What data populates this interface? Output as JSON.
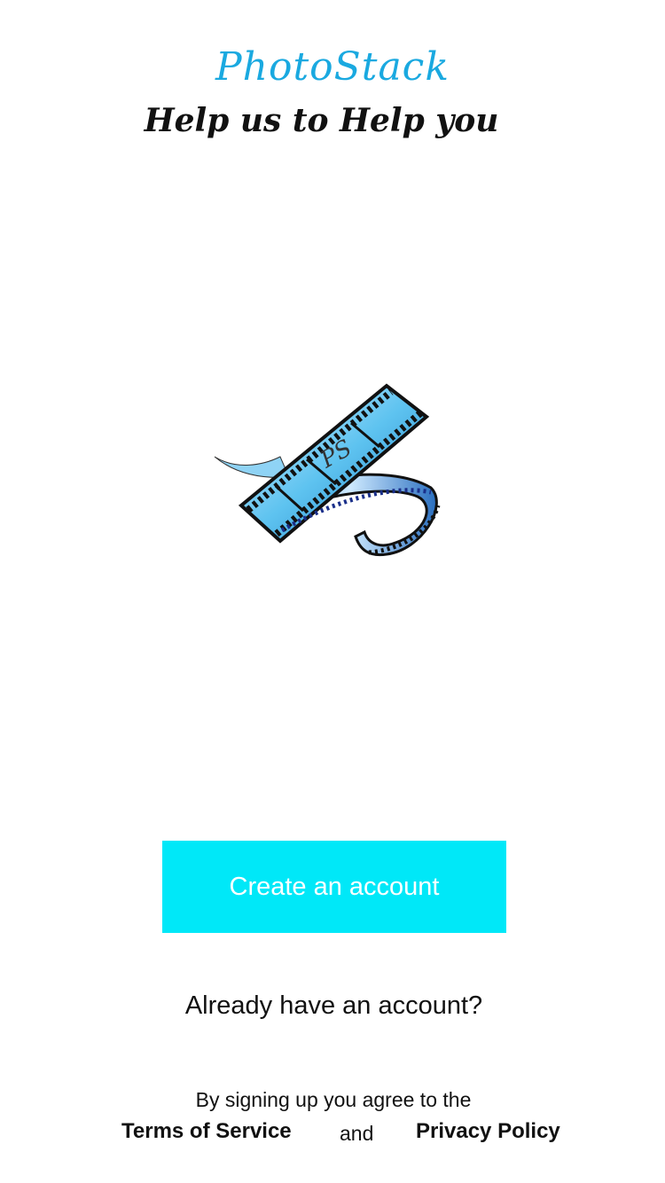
{
  "app": {
    "title": "PhotoStack",
    "subtitle": "Help us to Help you",
    "logo_monogram": "PS",
    "accent_color": "#1aa9e0",
    "button_color": "#00e8f8"
  },
  "actions": {
    "create_account_label": "Create an account",
    "login_label": "Already have an account?"
  },
  "legal": {
    "agree_text": "By signing up you agree to the",
    "terms_label": "Terms of Service",
    "and_text": "and",
    "privacy_label": "Privacy Policy"
  }
}
